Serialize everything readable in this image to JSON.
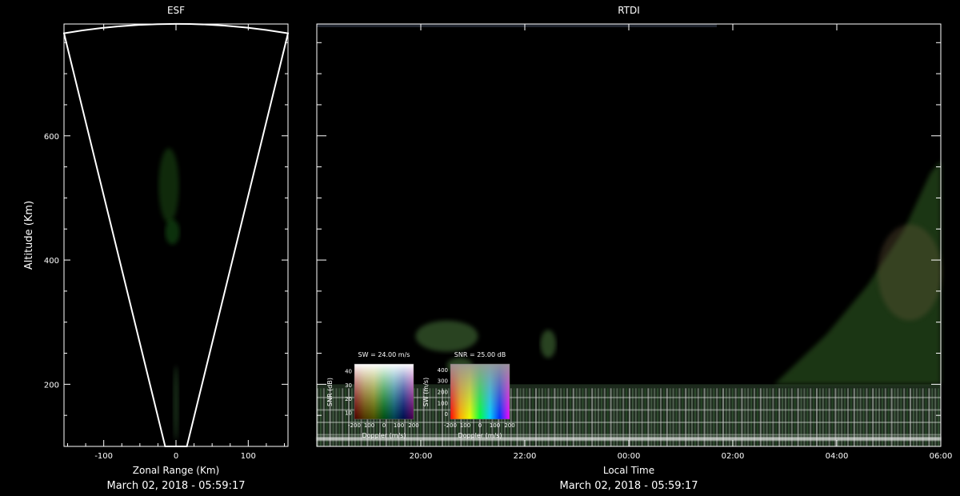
{
  "chart_data": [
    {
      "type": "scatter",
      "title": "ESF",
      "xlabel": "Zonal Range (Km)",
      "ylabel": "Altitude (Km)",
      "date_caption": "March 02, 2018 - 05:59:17",
      "xlim": [
        -155,
        155
      ],
      "ylim": [
        100,
        780
      ],
      "xticks": [
        -100,
        0,
        100
      ],
      "yticks": [
        200,
        400,
        600
      ],
      "fan_outline": {
        "apex_left": [
          -15,
          100
        ],
        "apex_right": [
          15,
          100
        ],
        "top_left": [
          -155,
          765
        ],
        "top_right": [
          155,
          765
        ],
        "top_mid": [
          0,
          780
        ]
      },
      "echoes": [
        {
          "x": -10,
          "y": 520,
          "rx": 14,
          "ry": 60,
          "color": "#2e7a20",
          "opacity": 0.35
        },
        {
          "x": -5,
          "y": 445,
          "rx": 10,
          "ry": 20,
          "color": "#1f6e1a",
          "opacity": 0.45
        },
        {
          "x": 0,
          "y": 170,
          "rx": 4,
          "ry": 60,
          "color": "#3a6a3a",
          "opacity": 0.4
        }
      ]
    },
    {
      "type": "heatmap",
      "title": "RTDI",
      "xlabel": "Local Time",
      "date_caption": "March 02, 2018 - 05:59:17",
      "xticks": [
        "20:00",
        "22:00",
        "00:00",
        "02:00",
        "04:00",
        "06:00"
      ],
      "y_range_note": "same altitude axis as ESF (100–780 km)",
      "echo_regions": [
        {
          "name": "bottom_layer",
          "start_hour": 18.0,
          "end_hour": 30.0,
          "alt_low": 100,
          "alt_high": 200
        },
        {
          "name": "evening_patch",
          "start_hour": 19.9,
          "end_hour": 21.1,
          "alt_low": 255,
          "alt_high": 300
        },
        {
          "name": "small_patch",
          "start_hour": 20.5,
          "end_hour": 21.0,
          "alt_low": 220,
          "alt_high": 240
        },
        {
          "name": "mid_patch",
          "start_hour": 22.3,
          "end_hour": 22.6,
          "alt_low": 245,
          "alt_high": 285
        },
        {
          "name": "morning_plume",
          "start_hour": 26.8,
          "end_hour": 30.0,
          "alt_low": 200,
          "alt_high": 560
        }
      ],
      "legends": [
        {
          "title": "SW = 24.00 m/s",
          "ylabel": "SNR (dB)",
          "yticks": [
            "10",
            "20",
            "30",
            "40"
          ],
          "xticks": [
            "-200",
            "100",
            "0",
            "100",
            "200"
          ],
          "xlabel": "Doppler (m/s)"
        },
        {
          "title": "SNR = 25.00 dB",
          "ylabel": "SW (m/s)",
          "yticks": [
            "0",
            "100",
            "200",
            "300",
            "400"
          ],
          "xticks": [
            "-200",
            "100",
            "0",
            "100",
            "200"
          ],
          "xlabel": "Doppler (m/s)"
        }
      ]
    }
  ]
}
